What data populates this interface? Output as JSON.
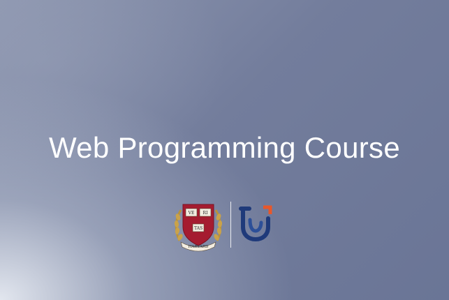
{
  "slide": {
    "title": "Web Programming Course"
  },
  "harvard_logo": {
    "icon": "harvard-shield-icon",
    "book_words": [
      "VE",
      "RI",
      "TAS"
    ],
    "ribbon_text": "HARVARD",
    "colors": {
      "shield": "#a51c30",
      "book": "#f3ede1",
      "wreath": "#b9923a"
    }
  },
  "partner_logo": {
    "icon": "partner-brand-icon",
    "colors": {
      "mark": "#1f3a7a",
      "accent": "#e8572a"
    }
  }
}
